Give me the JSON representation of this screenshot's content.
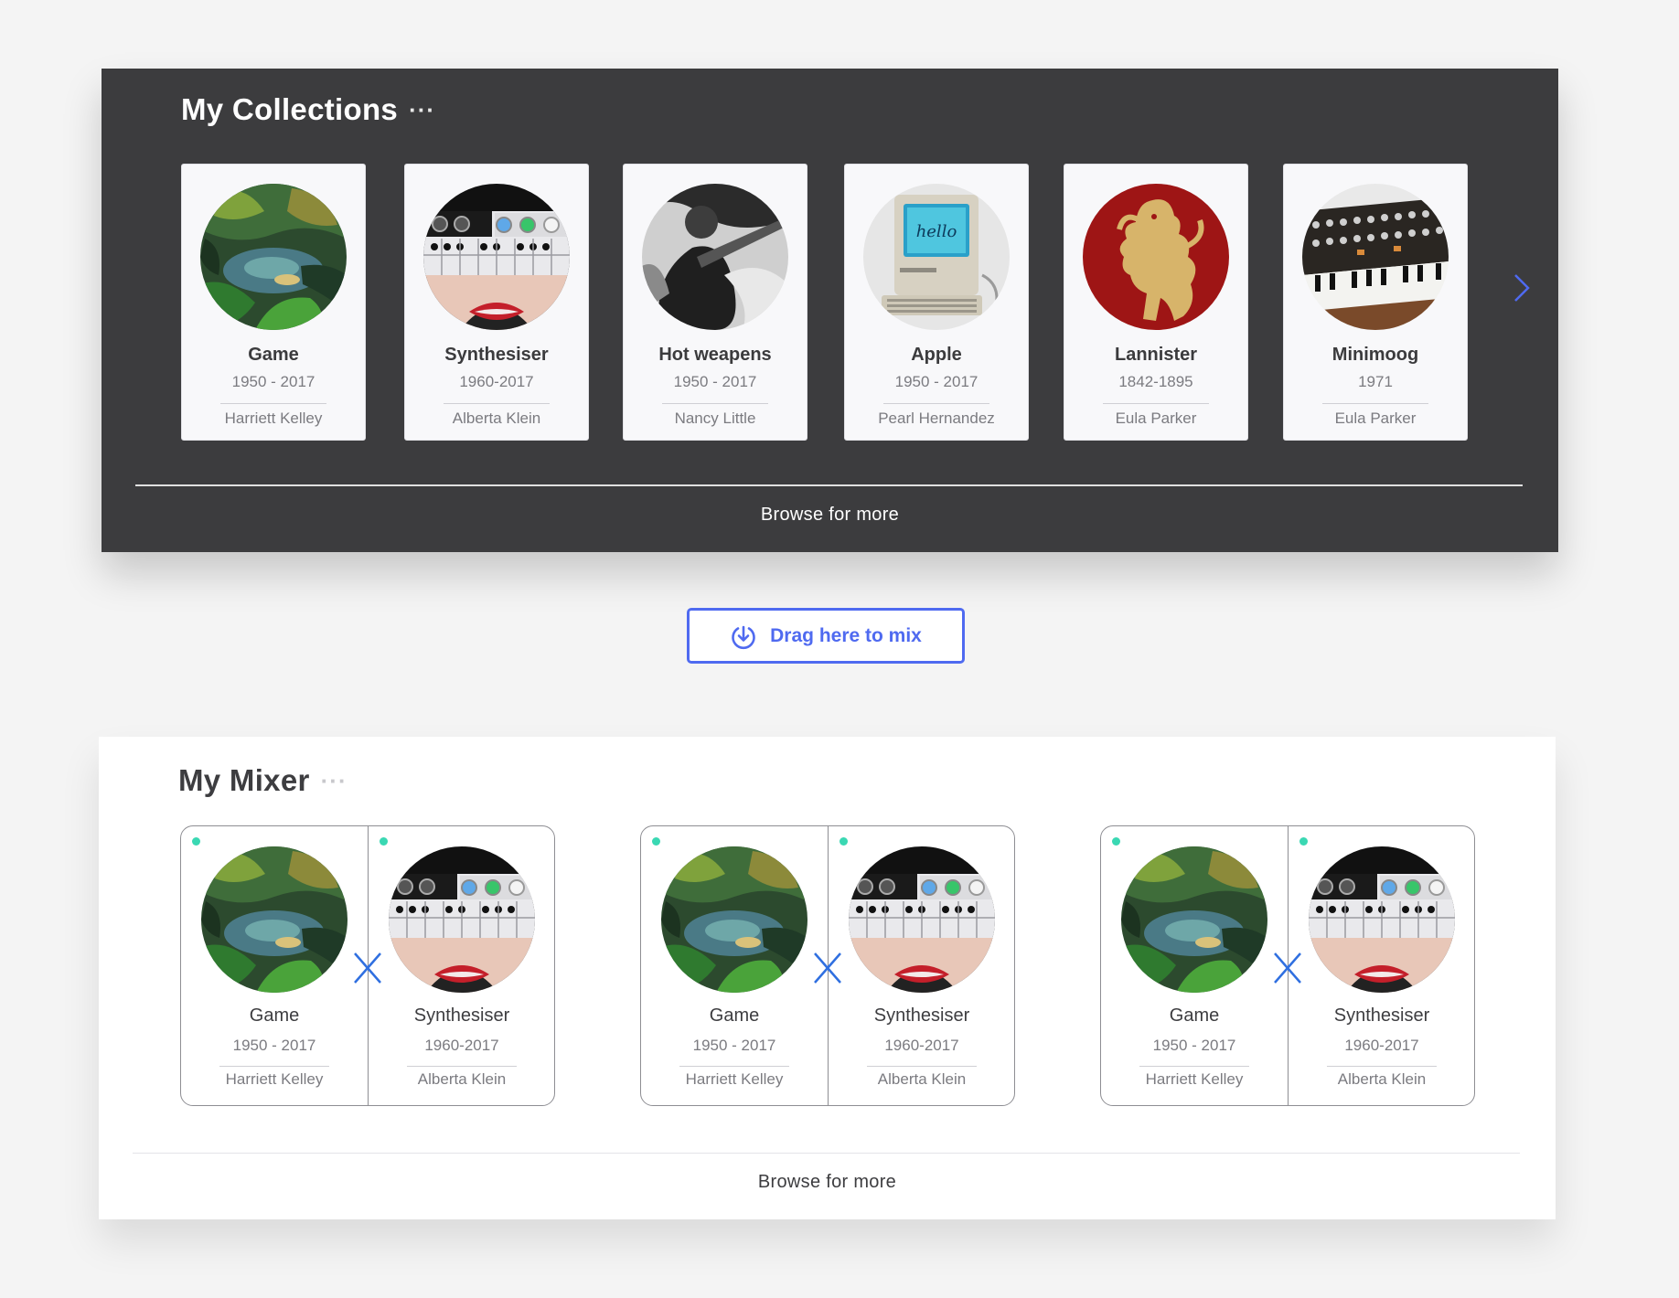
{
  "collections": {
    "title": "My Collections",
    "more_dots": "···",
    "items": [
      {
        "name": "Game",
        "years": "1950 - 2017",
        "owner": "Harriett Kelley",
        "image": "forest-scene"
      },
      {
        "name": "Synthesiser",
        "years": "1960-2017",
        "owner": "Alberta Klein",
        "image": "synth-keyboard-lips"
      },
      {
        "name": "Hot weapens",
        "years": "1950 - 2017",
        "owner": "Nancy Little",
        "image": "bw-photo"
      },
      {
        "name": "Apple",
        "years": "1950 - 2017",
        "owner": "Pearl Hernandez",
        "image": "macintosh-hello"
      },
      {
        "name": "Lannister",
        "years": "1842-1895",
        "owner": "Eula Parker",
        "image": "golden-lion-crest"
      },
      {
        "name": "Minimoog",
        "years": "1971",
        "owner": "Eula Parker",
        "image": "minimoog-synth"
      }
    ],
    "next_icon": "chevron-right-icon",
    "browse_label": "Browse for more"
  },
  "drag": {
    "label": "Drag here to mix",
    "icon": "download-circle-icon"
  },
  "mixer": {
    "title": "My Mixer",
    "more_dots": "···",
    "mixes": [
      {
        "left": {
          "name": "Game",
          "years": "1950 - 2017",
          "owner": "Harriett Kelley"
        },
        "right": {
          "name": "Synthesiser",
          "years": "1960-2017",
          "owner": "Alberta Klein"
        }
      },
      {
        "left": {
          "name": "Game",
          "years": "1950 - 2017",
          "owner": "Harriett Kelley"
        },
        "right": {
          "name": "Synthesiser",
          "years": "1960-2017",
          "owner": "Alberta Klein"
        }
      },
      {
        "left": {
          "name": "Game",
          "years": "1950 - 2017",
          "owner": "Harriett Kelley"
        },
        "right": {
          "name": "Synthesiser",
          "years": "1960-2017",
          "owner": "Alberta Klein"
        }
      }
    ],
    "mix_icon": "cross-icon",
    "browse_label": "Browse for more"
  },
  "colors": {
    "accent": "#4f6af0",
    "dark_panel": "#3c3c3e",
    "status_dot": "#3ad8b3",
    "mix_x": "#2f6fe0"
  }
}
